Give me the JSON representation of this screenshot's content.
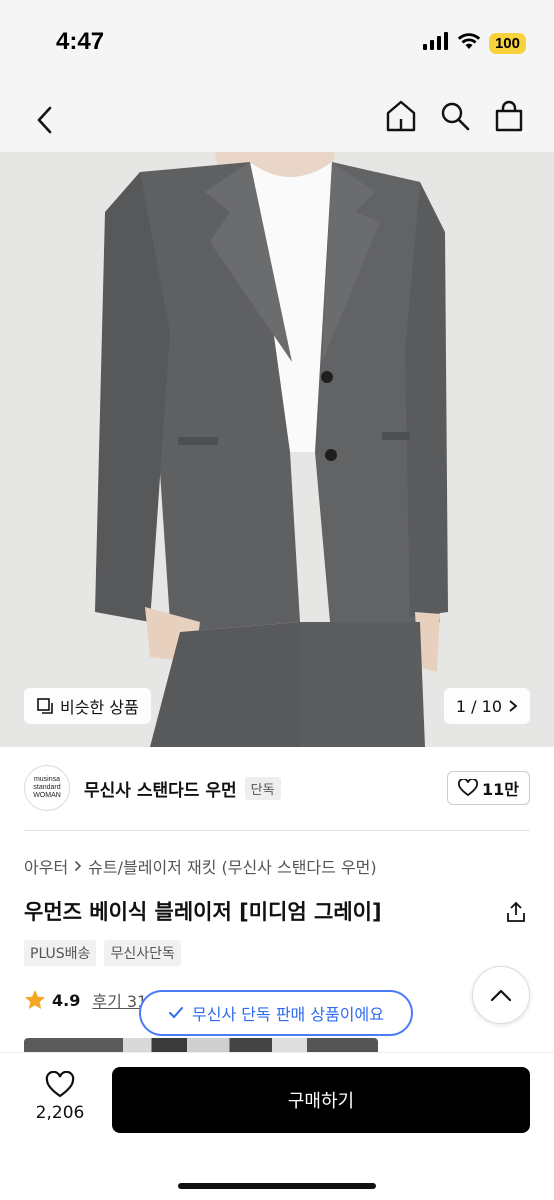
{
  "status_bar": {
    "time": "4:47",
    "battery": "100"
  },
  "nav": {
    "back_icon": "chevron-left-icon",
    "icons": [
      "home-icon",
      "search-icon",
      "shopping-bag-icon"
    ]
  },
  "hero": {
    "similar_label": "비슷한 상품",
    "pager": "1 / 10"
  },
  "brand": {
    "logo_lines": [
      "musinsa",
      "standard",
      "WOMAN"
    ],
    "name": "무신사 스탠다드 우먼",
    "tag": "단독",
    "likes": "11만"
  },
  "product": {
    "breadcrumb": [
      "아우터",
      "슈트/블레이저 재킷 (무신사 스탠다드 우먼)"
    ],
    "title": "우먼즈 베이식 블레이저 [미디엄 그레이]",
    "tags": [
      "PLUS배송",
      "무신사단독"
    ],
    "rating": "4.9",
    "review_label": "후기 31"
  },
  "toast": {
    "text": "무신사 단독 판매 상품이에요"
  },
  "bottom": {
    "wish_count": "2,206",
    "buy_label": "구매하기"
  },
  "colors": {
    "accent_blue": "#2f6cf0",
    "star": "#f5a623",
    "buy_bg": "#000000"
  }
}
